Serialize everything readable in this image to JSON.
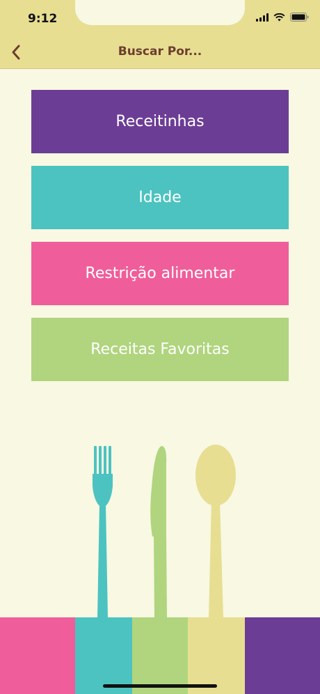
{
  "status_bar": {
    "time": "9:12"
  },
  "navbar": {
    "title": "Buscar Por..."
  },
  "menu": [
    {
      "label": "Receitinhas",
      "color": "#6c3d95"
    },
    {
      "label": "Idade",
      "color": "#4cc3c0"
    },
    {
      "label": "Restrição alimentar",
      "color": "#ef5e9a"
    },
    {
      "label": "Receitas Favoritas",
      "color": "#b0d57e"
    }
  ],
  "footer_colors": [
    "#ef5e9a",
    "#4cc3c0",
    "#b0d57e",
    "#e7de92",
    "#6c3d95"
  ],
  "colors": {
    "background": "#f8f8e3",
    "header": "#e7de92",
    "title": "#6b3e2e"
  }
}
